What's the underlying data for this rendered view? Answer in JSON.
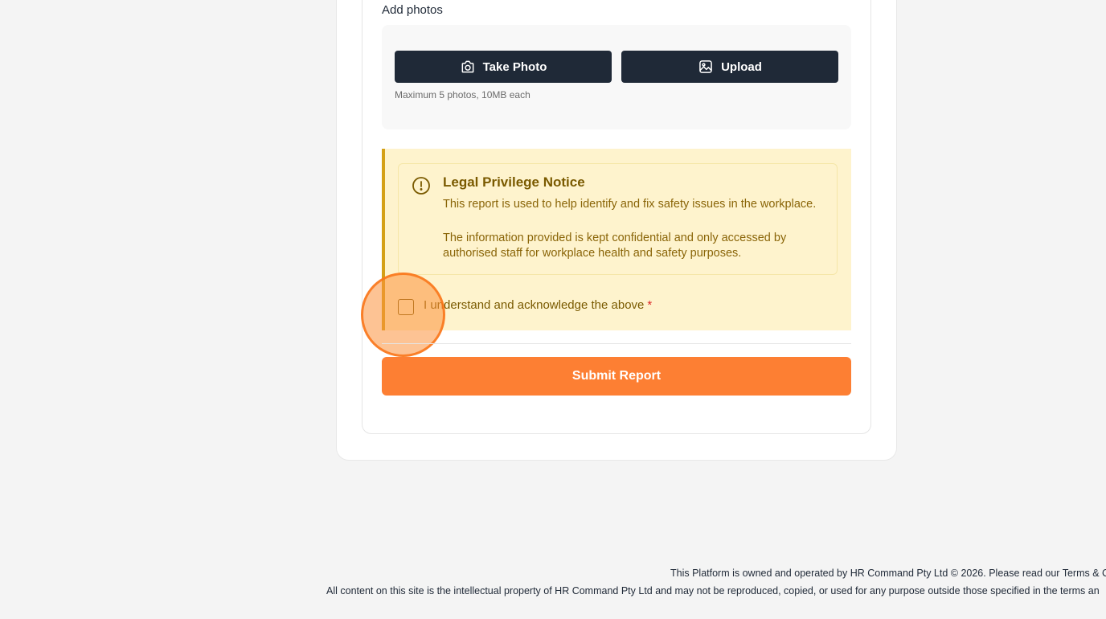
{
  "photos": {
    "label": "Add photos",
    "take_photo_label": "Take Photo",
    "take_photo_icon": "camera-icon",
    "upload_label": "Upload",
    "upload_icon": "image-icon",
    "hint": "Maximum 5 photos, 10MB each"
  },
  "notice": {
    "icon": "alert-circle-icon",
    "title": "Legal Privilege Notice",
    "paragraph1": "This report is used to help identify and fix safety issues in the workplace.",
    "paragraph2": "The information provided is kept confidential and only accessed by authorised staff for workplace health and safety purposes.",
    "ack_label": "I understand and acknowledge the above",
    "ack_required": "*",
    "ack_checked": false
  },
  "submit_label": "Submit Report",
  "footer": {
    "line1": "This Platform is owned and operated by HR Command Pty Ltd © 2026. Please read our Terms & Co",
    "line2": "All content on this site is the intellectual property of HR Command Pty Ltd and may not be reproduced, copied, or used for any purpose outside those specified in the terms an"
  },
  "colors": {
    "dark_button": "#1f2937",
    "accent_orange": "#fd7f33",
    "notice_bg": "#fef3cd",
    "notice_border": "#d4a017",
    "notice_text": "#7a5a00"
  }
}
